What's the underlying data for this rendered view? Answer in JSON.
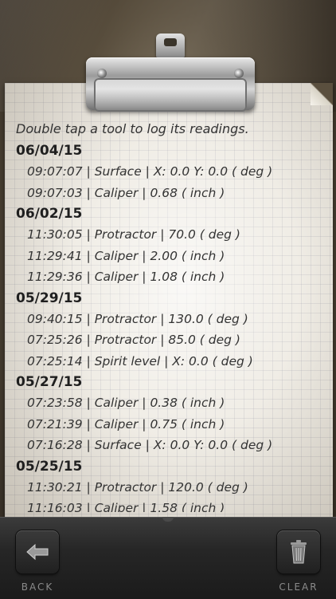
{
  "instruction": "Double tap a tool to log its readings.",
  "log": [
    {
      "date": "06/04/15",
      "entries": [
        "09:07:07 | Surface  | X: 0.0 Y: 0.0 ( deg )",
        "09:07:03 | Caliper  | 0.68 ( inch )"
      ]
    },
    {
      "date": "06/02/15",
      "entries": [
        "11:30:05 | Protractor  | 70.0 ( deg )",
        "11:29:41 | Caliper  | 2.00 ( inch )",
        "11:29:36 | Caliper  | 1.08 ( inch )"
      ]
    },
    {
      "date": "05/29/15",
      "entries": [
        "09:40:15 | Protractor  | 130.0 ( deg )",
        "07:25:26 | Protractor  | 85.0 ( deg )",
        "07:25:14 | Spirit  level | X: 0.0 ( deg )"
      ]
    },
    {
      "date": "05/27/15",
      "entries": [
        "07:23:58 | Caliper  | 0.38 ( inch )",
        "07:21:39 | Caliper  | 0.75 ( inch )",
        "07:16:28 | Surface  | X: 0.0 Y: 0.0 ( deg )"
      ]
    },
    {
      "date": "05/25/15",
      "entries": [
        "11:30:21 | Protractor  | 120.0 ( deg )",
        "11:16:03 | Caliper  | 1.58 ( inch )"
      ]
    }
  ],
  "toolbar": {
    "back_label": "BACK",
    "clear_label": "CLEAR",
    "back_icon": "arrow-left-icon",
    "clear_icon": "trash-icon"
  }
}
